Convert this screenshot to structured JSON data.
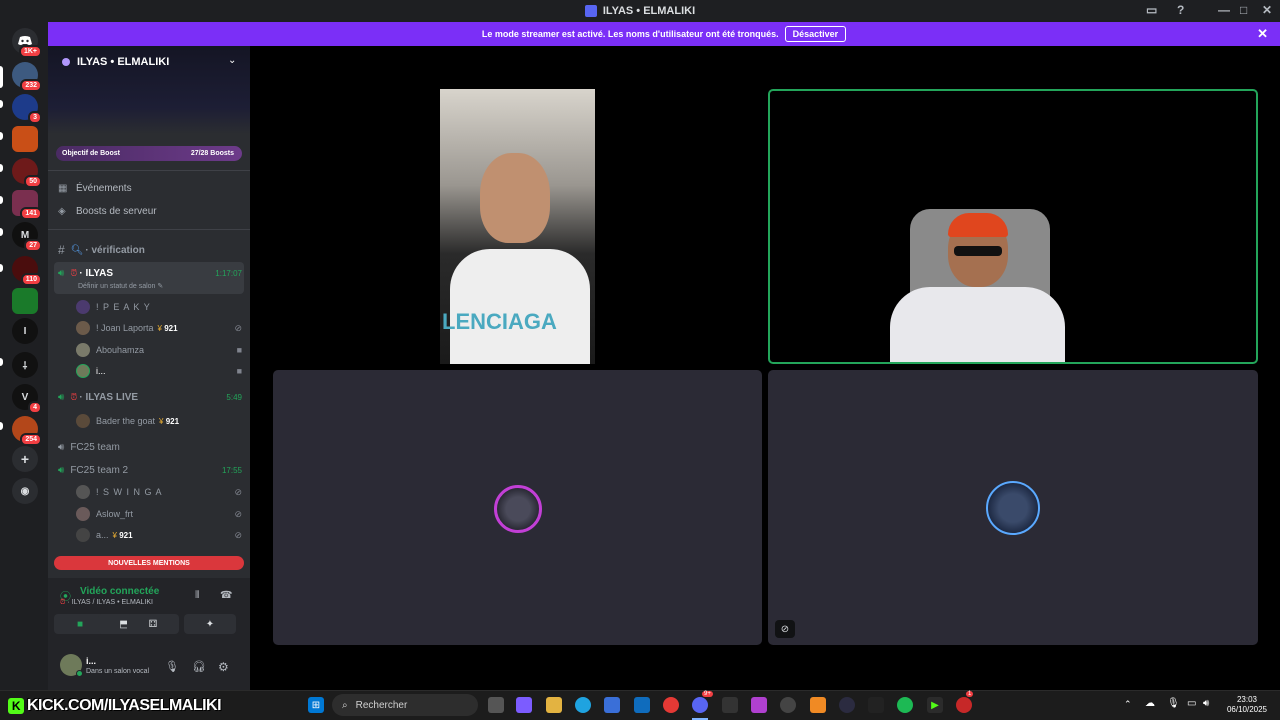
{
  "window": {
    "title": "ILYAS • ELMALIKI"
  },
  "banner": {
    "text": "Le mode streamer est activé. Les noms d'utilisateur ont été tronqués.",
    "button": "Désactiver"
  },
  "rail": {
    "badges": [
      "1K+",
      "232",
      "3",
      "50",
      "141",
      "27",
      "110",
      "4",
      "254"
    ],
    "letters": [
      "I",
      "V"
    ]
  },
  "server": {
    "name": "ILYAS • ELMALIKI",
    "boost_label": "Objectif de Boost",
    "boost_count": "27/28 Boosts"
  },
  "nav": {
    "events": "Événements",
    "boosts": "Boosts de serveur"
  },
  "channels": {
    "verification": "· vérification",
    "ilyas": "· ILYAS",
    "ilyas_time": "1:17:07",
    "ilyas_status": "Définir un statut de salon",
    "ilyas_live": "· ILYAS LIVE",
    "ilyas_live_time": "5:49",
    "fc25": "FC25 team",
    "fc25_2": "FC25 team 2",
    "fc25_2_time": "17:55"
  },
  "users": {
    "peaky": "! P E A K Y",
    "laporta": "! Joan Laporta",
    "laporta_nitro": "921",
    "abouhamza": "Abouhamza",
    "i_user": "i...",
    "bader": "Bader the goat",
    "bader_nitro": "921",
    "swinga": "! S W I N G A",
    "aslow": "Aslow_frt",
    "a_user": "a...",
    "a_nitro": "921"
  },
  "mentions": "NOUVELLES MENTIONS",
  "voice": {
    "title": "Vidéo connectée",
    "sub": "ILYAS / ILYAS • ELMALIKI",
    "me_name": "i...",
    "me_status": "Dans un salon vocal"
  },
  "taskbar": {
    "kick": "KICK.COM/ILYASELMALIKI",
    "search": "Rechercher",
    "time": "23:03",
    "date": "06/10/2025",
    "discord_badge": "9+",
    "app_badge": "1"
  },
  "colors": {
    "accent": "#7b2ff7",
    "voice_green": "#23a55a",
    "danger": "#da373c"
  }
}
